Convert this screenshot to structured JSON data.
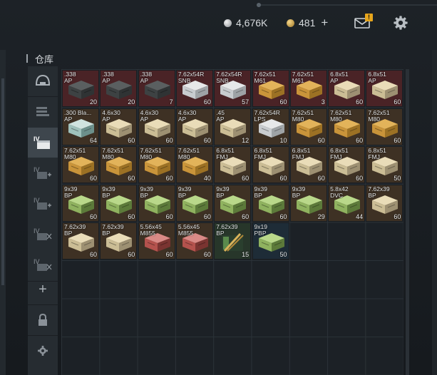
{
  "header": {
    "silver_amount": "4,676K",
    "gold_amount": "481",
    "plus_label": "+",
    "mail_badge": "!"
  },
  "panel": {
    "title": "仓库"
  },
  "sidebar": {
    "items": [
      {
        "icon": "helmet-icon",
        "label": ""
      },
      {
        "icon": "storage-shelf-icon",
        "label": ""
      },
      {
        "icon": "storage-box-icon",
        "label": "IV"
      },
      {
        "icon": "storage-box-add-icon",
        "label": "IV"
      },
      {
        "icon": "storage-box-add-icon",
        "label": "IV"
      },
      {
        "icon": "storage-box-add-icon",
        "label": "IV"
      },
      {
        "icon": "storage-box-add-icon",
        "label": "IV"
      },
      {
        "icon": "plus-icon",
        "label": "+"
      },
      {
        "icon": "lock-icon",
        "label": ""
      },
      {
        "icon": "gear-icon",
        "label": ""
      }
    ]
  },
  "colors": {
    "red_cell": "#4a2326",
    "brown_cell": "#3e3124",
    "blue_cell": "#1e2c37",
    "green_cell": "#27362a",
    "gold_coin": "#d1a545",
    "badge": "#e6a51c"
  },
  "inventory": [
    {
      "name": ".338\nAP",
      "count": "20",
      "bg": "red",
      "box": "dark"
    },
    {
      "name": ".338\nAP",
      "count": "20",
      "bg": "red",
      "box": "dark"
    },
    {
      "name": ".338\nAP",
      "count": "7",
      "bg": "red",
      "box": "dark"
    },
    {
      "name": "7.62x54R\nSNB",
      "count": "60",
      "bg": "red",
      "box": "white"
    },
    {
      "name": "7.62x54R\nSNB",
      "count": "57",
      "bg": "red",
      "box": "white"
    },
    {
      "name": "7.62x51\nM61",
      "count": "60",
      "bg": "red",
      "box": "tan"
    },
    {
      "name": "7.62x51\nM61",
      "count": "3",
      "bg": "red",
      "box": "tan"
    },
    {
      "name": "6.8x51\nAP",
      "count": "60",
      "bg": "red",
      "box": "beige"
    },
    {
      "name": "6.8x51\nAP",
      "count": "60",
      "bg": "red",
      "box": "beige"
    },
    {
      "name": ".300 Bla...\nAP",
      "count": "64",
      "bg": "brown",
      "box": "teal"
    },
    {
      "name": "4.6x30\nAP",
      "count": "60",
      "bg": "brown",
      "box": "beige"
    },
    {
      "name": "4.6x30\nAP",
      "count": "60",
      "bg": "brown",
      "box": "beige"
    },
    {
      "name": "4.6x30\nAP",
      "count": "60",
      "bg": "brown",
      "box": "beige"
    },
    {
      "name": ".45\nAP",
      "count": "12",
      "bg": "brown",
      "box": "beige"
    },
    {
      "name": "7.62x54R\nLPS",
      "count": "10",
      "bg": "brown",
      "box": "white"
    },
    {
      "name": "7.62x51\nM80",
      "count": "60",
      "bg": "brown",
      "box": "tan"
    },
    {
      "name": "7.62x51\nM80",
      "count": "60",
      "bg": "brown",
      "box": "tan"
    },
    {
      "name": "7.62x51\nM80",
      "count": "60",
      "bg": "brown",
      "box": "tan"
    },
    {
      "name": "7.62x51\nM80",
      "count": "60",
      "bg": "brown",
      "box": "tan"
    },
    {
      "name": "7.62x51\nM80",
      "count": "60",
      "bg": "brown",
      "box": "tan"
    },
    {
      "name": "7.62x51\nM80",
      "count": "60",
      "bg": "brown",
      "box": "tan"
    },
    {
      "name": "7.62x51\nM80",
      "count": "40",
      "bg": "brown",
      "box": "tan"
    },
    {
      "name": "6.8x51\nFMJ",
      "count": "60",
      "bg": "brown",
      "box": "beige"
    },
    {
      "name": "6.8x51\nFMJ",
      "count": "60",
      "bg": "brown",
      "box": "beige"
    },
    {
      "name": "6.8x51\nFMJ",
      "count": "60",
      "bg": "brown",
      "box": "beige"
    },
    {
      "name": "6.8x51\nFMJ",
      "count": "60",
      "bg": "brown",
      "box": "beige"
    },
    {
      "name": "6.8x51\nFMJ",
      "count": "50",
      "bg": "brown",
      "box": "beige"
    },
    {
      "name": "9x39\nBP",
      "count": "60",
      "bg": "brown",
      "box": "green"
    },
    {
      "name": "9x39\nBP",
      "count": "60",
      "bg": "brown",
      "box": "green"
    },
    {
      "name": "9x39\nBP",
      "count": "60",
      "bg": "brown",
      "box": "green"
    },
    {
      "name": "9x39\nBP",
      "count": "60",
      "bg": "brown",
      "box": "green"
    },
    {
      "name": "9x39\nBP",
      "count": "60",
      "bg": "brown",
      "box": "green"
    },
    {
      "name": "9x39\nBP",
      "count": "60",
      "bg": "brown",
      "box": "green"
    },
    {
      "name": "9x39\nBP",
      "count": "29",
      "bg": "brown",
      "box": "green"
    },
    {
      "name": "5.8x42\nDVC",
      "count": "44",
      "bg": "brown",
      "box": "green"
    },
    {
      "name": "7.62x39\nBP",
      "count": "60",
      "bg": "brown",
      "box": "beige"
    },
    {
      "name": "7.62x39\nBP",
      "count": "60",
      "bg": "brown",
      "box": "beige"
    },
    {
      "name": "7.62x39\nBP",
      "count": "60",
      "bg": "brown",
      "box": "beige"
    },
    {
      "name": "5.56x45\nM855",
      "count": "60",
      "bg": "brown",
      "box": "red"
    },
    {
      "name": "5.56x45\nM855",
      "count": "60",
      "bg": "brown",
      "box": "red"
    },
    {
      "name": "7.62x39\nBP",
      "count": "15",
      "bg": "green",
      "box": "bullets"
    },
    {
      "name": "9x19\nPBP",
      "count": "50",
      "bg": "blue",
      "box": "green"
    }
  ]
}
